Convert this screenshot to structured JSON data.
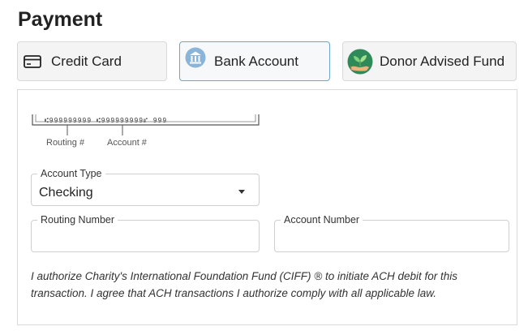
{
  "title": "Payment",
  "tabs": {
    "credit_card": {
      "label": "Credit Card",
      "icon": "credit-card-icon"
    },
    "bank_account": {
      "label": "Bank Account",
      "icon": "bank-icon",
      "active": true
    },
    "donor_advised_fund": {
      "label": "Donor Advised Fund",
      "icon": "plant-hand-icon"
    }
  },
  "check_illustration": {
    "micr_line": "⑆999999999 ⑆999999999⑈ 999",
    "routing_caption": "Routing #",
    "account_caption": "Account #"
  },
  "account_type": {
    "label": "Account Type",
    "value": "Checking"
  },
  "routing_number": {
    "label": "Routing Number",
    "value": ""
  },
  "account_number": {
    "label": "Account Number",
    "value": ""
  },
  "authorization_text": "I authorize Charity's International Foundation Fund (CIFF) ® to initiate ACH debit for this transaction. I agree that ACH transactions I authorize comply with all applicable law.",
  "colors": {
    "active_tab_border": "#6fa6cf",
    "bank_icon_bg": "#8ab4d8",
    "daf_icon_bg": "#2f8a5a"
  }
}
